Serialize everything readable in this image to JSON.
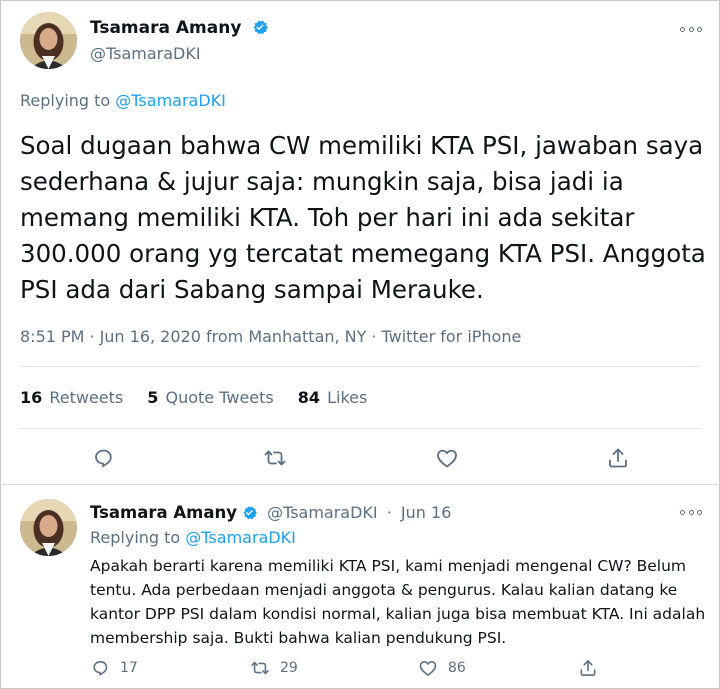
{
  "main_tweet": {
    "author_name": "Tsamara Amany",
    "author_handle": "@TsamaraDKI",
    "replying_prefix": "Replying to",
    "replying_to": "@TsamaraDKI",
    "text": "Soal dugaan bahwa CW memiliki KTA PSI, jawaban saya sederhana & jujur saja: mungkin saja, bisa jadi ia memang memiliki KTA. Toh per hari ini ada sekitar 300.000 orang yg tercatat memegang KTA PSI. Anggota PSI ada dari Sabang sampai Merauke.",
    "time": "8:51 PM",
    "date": "Jun 16, 2020",
    "location": "from Manhattan, NY",
    "source": "Twitter for iPhone",
    "separator": "·",
    "stats": {
      "retweets_count": "16",
      "retweets_label": "Retweets",
      "quotes_count": "5",
      "quotes_label": "Quote Tweets",
      "likes_count": "84",
      "likes_label": "Likes"
    },
    "actions": [
      "reply-icon",
      "retweet-icon",
      "like-icon",
      "share-icon"
    ]
  },
  "reply_tweet": {
    "author_name": "Tsamara Amany",
    "author_handle": "@TsamaraDKI",
    "date": "Jun 16",
    "separator": "·",
    "replying_prefix": "Replying to",
    "replying_to": "@TsamaraDKI",
    "text": "Apakah berarti karena memiliki KTA PSI, kami menjadi mengenal CW? Belum tentu. Ada perbedaan menjadi anggota & pengurus. Kalau kalian datang ke kantor DPP PSI dalam kondisi normal, kalian juga bisa membuat KTA. Ini adalah membership saja. Bukti bahwa kalian pendukung PSI.",
    "reply_count": "17",
    "retweet_count": "29",
    "like_count": "86"
  },
  "colors": {
    "accent": "#1da1f2",
    "secondary_text": "#5b7083",
    "primary_text": "#0f1419",
    "divider": "#e1e8ed"
  }
}
